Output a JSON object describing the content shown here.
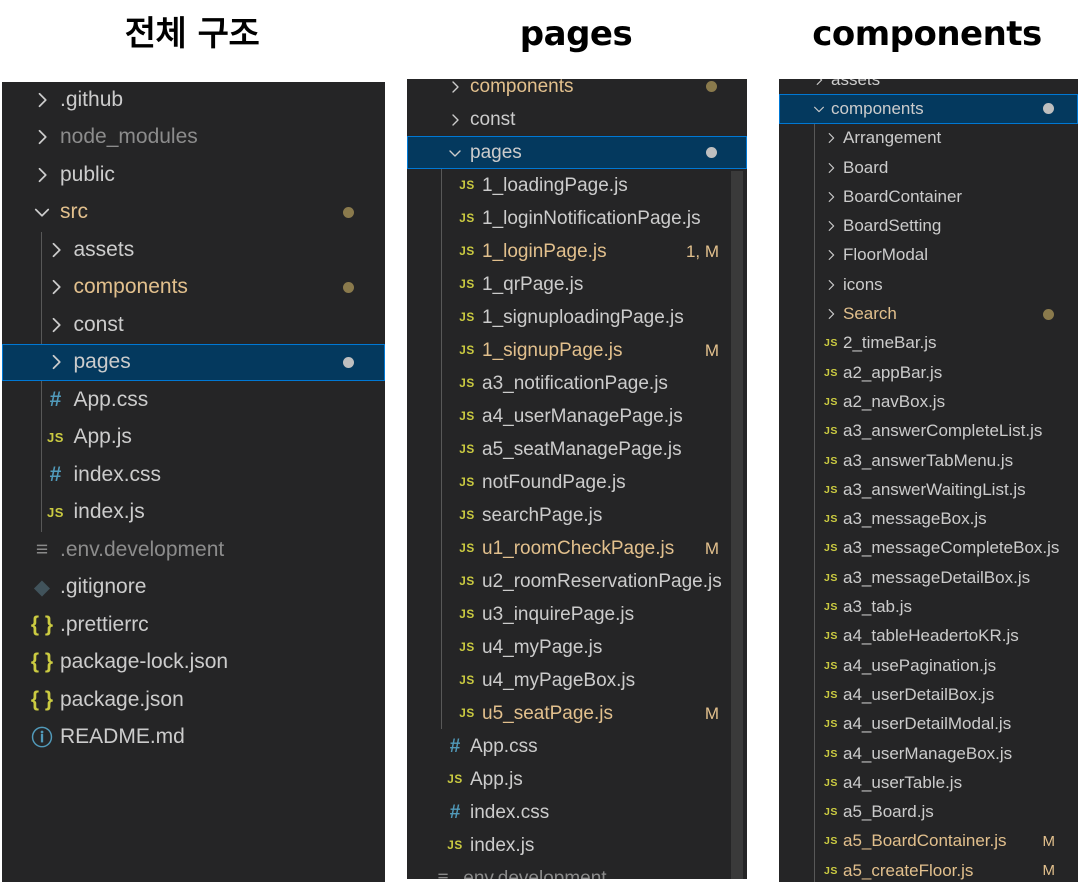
{
  "headings": {
    "overall": "전체 구조",
    "pages": "pages",
    "components": "components"
  },
  "panel1": {
    "rows": [
      {
        "type": "folder",
        "open": false,
        "label": ".github",
        "depth": 0
      },
      {
        "type": "folder",
        "open": false,
        "label": "node_modules",
        "depth": 0,
        "dim": true
      },
      {
        "type": "folder",
        "open": false,
        "label": "public",
        "depth": 0
      },
      {
        "type": "folder",
        "open": true,
        "label": "src",
        "depth": 0,
        "modified": true,
        "dot": true
      },
      {
        "type": "folder",
        "open": false,
        "label": "assets",
        "depth": 1
      },
      {
        "type": "folder",
        "open": false,
        "label": "components",
        "depth": 1,
        "modified": true,
        "dot": true
      },
      {
        "type": "folder",
        "open": false,
        "label": "const",
        "depth": 1
      },
      {
        "type": "folder",
        "open": false,
        "label": "pages",
        "depth": 1,
        "selected": true,
        "dot": true
      },
      {
        "type": "css",
        "label": "App.css",
        "depth": 1
      },
      {
        "type": "js",
        "label": "App.js",
        "depth": 1
      },
      {
        "type": "css",
        "label": "index.css",
        "depth": 1
      },
      {
        "type": "js",
        "label": "index.js",
        "depth": 1
      },
      {
        "type": "env",
        "label": ".env.development",
        "depth": 0,
        "dim": true
      },
      {
        "type": "git",
        "label": ".gitignore",
        "depth": 0
      },
      {
        "type": "json",
        "label": ".prettierrc",
        "depth": 0
      },
      {
        "type": "json",
        "label": "package-lock.json",
        "depth": 0
      },
      {
        "type": "json",
        "label": "package.json",
        "depth": 0
      },
      {
        "type": "info",
        "label": "README.md",
        "depth": 0
      }
    ]
  },
  "panel2": {
    "rows": [
      {
        "type": "folder",
        "open": false,
        "label": "components",
        "depth": 0,
        "modified": true,
        "dot": true
      },
      {
        "type": "folder",
        "open": false,
        "label": "const",
        "depth": 0
      },
      {
        "type": "folder",
        "open": true,
        "label": "pages",
        "depth": 0,
        "selected": true,
        "dot": true
      },
      {
        "type": "js",
        "label": "1_loadingPage.js",
        "depth": 1
      },
      {
        "type": "js",
        "label": "1_loginNotificationPage.js",
        "depth": 1
      },
      {
        "type": "js",
        "label": "1_loginPage.js",
        "depth": 1,
        "modified": true,
        "badge": "1, M"
      },
      {
        "type": "js",
        "label": "1_qrPage.js",
        "depth": 1
      },
      {
        "type": "js",
        "label": "1_signuploadingPage.js",
        "depth": 1
      },
      {
        "type": "js",
        "label": "1_signupPage.js",
        "depth": 1,
        "modified": true,
        "badge": "M"
      },
      {
        "type": "js",
        "label": "a3_notificationPage.js",
        "depth": 1
      },
      {
        "type": "js",
        "label": "a4_userManagePage.js",
        "depth": 1
      },
      {
        "type": "js",
        "label": "a5_seatManagePage.js",
        "depth": 1
      },
      {
        "type": "js",
        "label": "notFoundPage.js",
        "depth": 1
      },
      {
        "type": "js",
        "label": "searchPage.js",
        "depth": 1
      },
      {
        "type": "js",
        "label": "u1_roomCheckPage.js",
        "depth": 1,
        "modified": true,
        "badge": "M"
      },
      {
        "type": "js",
        "label": "u2_roomReservationPage.js",
        "depth": 1
      },
      {
        "type": "js",
        "label": "u3_inquirePage.js",
        "depth": 1
      },
      {
        "type": "js",
        "label": "u4_myPage.js",
        "depth": 1
      },
      {
        "type": "js",
        "label": "u4_myPageBox.js",
        "depth": 1
      },
      {
        "type": "js",
        "label": "u5_seatPage.js",
        "depth": 1,
        "modified": true,
        "badge": "M"
      },
      {
        "type": "css",
        "label": "App.css",
        "depth": 0
      },
      {
        "type": "js",
        "label": "App.js",
        "depth": 0
      },
      {
        "type": "css",
        "label": "index.css",
        "depth": 0
      },
      {
        "type": "js",
        "label": "index.js",
        "depth": 0
      },
      {
        "type": "env",
        "label": ".env.development",
        "depth": -1,
        "dim": true
      }
    ]
  },
  "panel3": {
    "rows": [
      {
        "type": "folder",
        "open": false,
        "label": "assets",
        "depth": 0
      },
      {
        "type": "folder",
        "open": true,
        "label": "components",
        "depth": 0,
        "selected": true,
        "dot": true
      },
      {
        "type": "folder",
        "open": false,
        "label": "Arrangement",
        "depth": 1
      },
      {
        "type": "folder",
        "open": false,
        "label": "Board",
        "depth": 1
      },
      {
        "type": "folder",
        "open": false,
        "label": "BoardContainer",
        "depth": 1
      },
      {
        "type": "folder",
        "open": false,
        "label": "BoardSetting",
        "depth": 1
      },
      {
        "type": "folder",
        "open": false,
        "label": "FloorModal",
        "depth": 1
      },
      {
        "type": "folder",
        "open": false,
        "label": "icons",
        "depth": 1
      },
      {
        "type": "folder",
        "open": false,
        "label": "Search",
        "depth": 1,
        "modified": true,
        "dot": true
      },
      {
        "type": "js",
        "label": "2_timeBar.js",
        "depth": 1
      },
      {
        "type": "js",
        "label": "a2_appBar.js",
        "depth": 1
      },
      {
        "type": "js",
        "label": "a2_navBox.js",
        "depth": 1
      },
      {
        "type": "js",
        "label": "a3_answerCompleteList.js",
        "depth": 1
      },
      {
        "type": "js",
        "label": "a3_answerTabMenu.js",
        "depth": 1
      },
      {
        "type": "js",
        "label": "a3_answerWaitingList.js",
        "depth": 1
      },
      {
        "type": "js",
        "label": "a3_messageBox.js",
        "depth": 1
      },
      {
        "type": "js",
        "label": "a3_messageCompleteBox.js",
        "depth": 1
      },
      {
        "type": "js",
        "label": "a3_messageDetailBox.js",
        "depth": 1
      },
      {
        "type": "js",
        "label": "a3_tab.js",
        "depth": 1
      },
      {
        "type": "js",
        "label": "a4_tableHeadertoKR.js",
        "depth": 1
      },
      {
        "type": "js",
        "label": "a4_usePagination.js",
        "depth": 1
      },
      {
        "type": "js",
        "label": "a4_userDetailBox.js",
        "depth": 1
      },
      {
        "type": "js",
        "label": "a4_userDetailModal.js",
        "depth": 1
      },
      {
        "type": "js",
        "label": "a4_userManageBox.js",
        "depth": 1
      },
      {
        "type": "js",
        "label": "a4_userTable.js",
        "depth": 1
      },
      {
        "type": "js",
        "label": "a5_Board.js",
        "depth": 1
      },
      {
        "type": "js",
        "label": "a5_BoardContainer.js",
        "depth": 1,
        "modified": true,
        "badge": "M"
      },
      {
        "type": "js",
        "label": "a5_createFloor.js",
        "depth": 1,
        "modified": true,
        "badge": "M"
      }
    ]
  },
  "icons": {
    "js": "JS",
    "css": "#",
    "json": "{ }",
    "env": "≡",
    "git": "◆",
    "info": "ⓘ"
  },
  "colors": {
    "sidebar_bg": "#252526",
    "text": "#cccccc",
    "modified": "#e2c08d",
    "selected_bg": "#04395e",
    "selected_border": "#0078d4",
    "js_icon": "#cbcb41",
    "css_icon": "#519aba"
  }
}
